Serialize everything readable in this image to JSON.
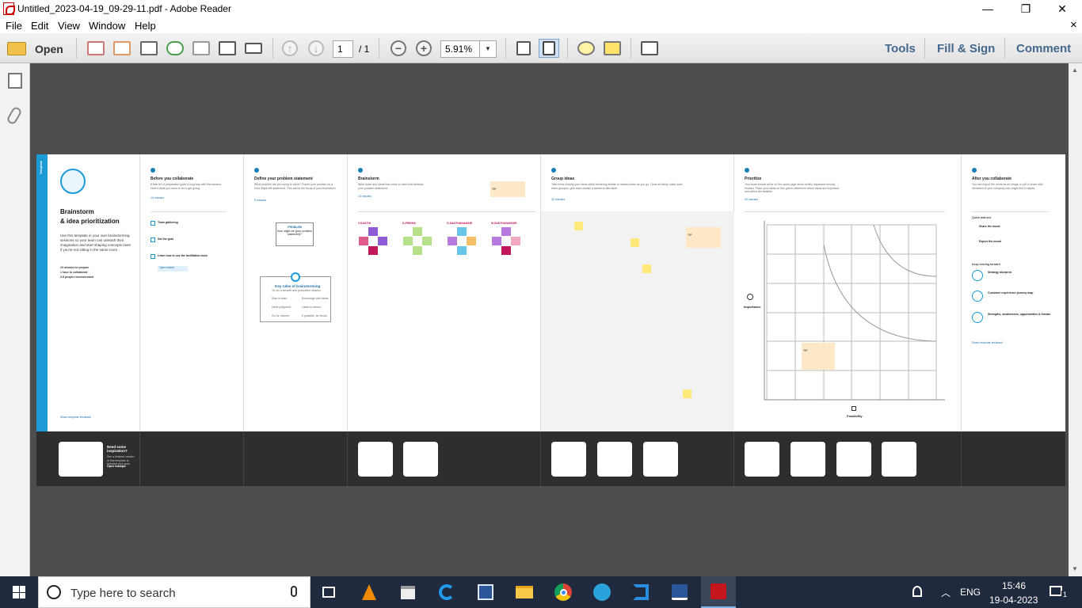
{
  "window": {
    "title": "Untitled_2023-04-19_09-29-11.pdf - Adobe Reader",
    "minimize": "—",
    "maximize": "❐",
    "close": "✕"
  },
  "menu": {
    "items": [
      "File",
      "Edit",
      "View",
      "Window",
      "Help"
    ],
    "close_x": "×"
  },
  "toolbar": {
    "open_label": "Open",
    "page_current": "1",
    "page_total": "/ 1",
    "zoom": "5.91%",
    "tools": "Tools",
    "fill_sign": "Fill & Sign",
    "comment": "Comment"
  },
  "template": {
    "tag": "Template",
    "title_line1": "Brainstorm",
    "title_line2": "& idea prioritization",
    "intro": "Use this template in your own brainstorming sessions so your team can unleash their imagination and start shaping concepts even if you're not sitting in the same room.",
    "meta": [
      "10 minutes to prepare",
      "1 hour to collaborate",
      "2-8 people recommended"
    ],
    "share": "Share template feedback",
    "band_title": "Need some inspiration?",
    "band_text": "See a finished version of this template to kickstart your work.",
    "band_button": "Open example"
  },
  "sections": [
    {
      "title": "Before you collaborate",
      "text": "A little bit of preparation goes a long way with this session. Here's what you need to do to get going.",
      "time": "10 minutes",
      "steps": [
        "Team gathering",
        "Set the goal",
        "Learn how to use the facilitation tools"
      ],
      "button": "Open article"
    },
    {
      "title": "Define your problem statement",
      "text": "What problem are you trying to solve? Frame your problem as a How Might We statement. This will be the focus of your brainstorm.",
      "time": "5 minutes",
      "card_label": "PROBLEM",
      "card_text": "How might we [your problem statement]?",
      "rules_title": "Key rules of brainstorming",
      "rules_sub": "To run a smooth and productive session",
      "rules": [
        "Stay in topic.",
        "Encourage wild ideas.",
        "Defer judgment.",
        "Listen to others.",
        "Go for volume.",
        "If possible, be visual."
      ]
    },
    {
      "title": "Brainstorm",
      "text": "Write down any ideas that come to mind that address your problem statement.",
      "time": "10 minutes",
      "names": [
        "V.SAKTHI",
        "D.PRIDHA",
        "G.SANTHANAMARI",
        "M.SANTHANAMARI"
      ],
      "tip": "TIP"
    },
    {
      "title": "Group ideas",
      "text": "Take turns sharing your ideas while clustering similar or related notes as you go. Once all sticky notes have been grouped, give each cluster a sentence-like label.",
      "time": "20 minutes",
      "tip": "TIP"
    },
    {
      "title": "Prioritize",
      "text": "Your team should all be on the same page about what's important moving forward. Place your ideas on this grid to determine which ideas are important and which are feasible.",
      "time": "20 minutes",
      "y_label": "Importance",
      "x_label": "Feasibility",
      "tip": "TIP"
    },
    {
      "title": "After you collaborate",
      "text": "You can export the mural as an image or pdf to share with members of your company who might find it helpful.",
      "quick_title": "Quick add-ons",
      "quick": [
        "Share the mural",
        "Export the mural"
      ],
      "keep_title": "Keep moving forward",
      "keep": [
        "Strategy blueprint",
        "Customer experience journey map",
        "Strengths, weaknesses, opportunities & threats"
      ],
      "share": "Share template feedback"
    }
  ],
  "taskbar": {
    "search_placeholder": "Type here to search",
    "lang": "ENG",
    "time": "15:46",
    "date": "19-04-2023",
    "notif_count": "1"
  }
}
